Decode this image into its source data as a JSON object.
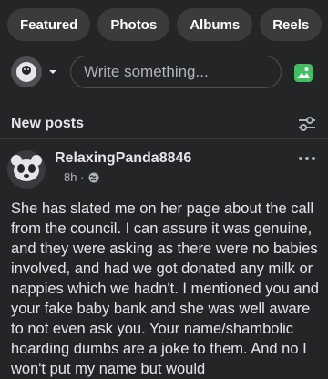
{
  "tabs": [
    {
      "label": "Featured"
    },
    {
      "label": "Photos"
    },
    {
      "label": "Albums"
    },
    {
      "label": "Reels"
    }
  ],
  "composer": {
    "placeholder": "Write something...",
    "avatar_icon": "profile-face-icon",
    "photo_icon": "photo-icon"
  },
  "section": {
    "title": "New posts",
    "filter_icon": "sliders-icon"
  },
  "post": {
    "author": "RelaxingPanda8846",
    "time": "8h",
    "privacy_icon": "globe-icon",
    "text": "She has slated me on her page about the call from the council. I can assure it was genuine, and they were asking as there were no babies involved, and had we got donated any milk or nappies which we hadn't. I mentioned you and your fake baby bank and she was well aware to not even ask you. Your name/shambolic hoarding dumbs are a joke to them. And no I won't put my name but would"
  },
  "colors": {
    "background": "#242526",
    "tab_bg": "#3a3b3c",
    "text": "#e4e6eb",
    "muted": "#b0b3b8",
    "photo_green": "#45bd62"
  }
}
